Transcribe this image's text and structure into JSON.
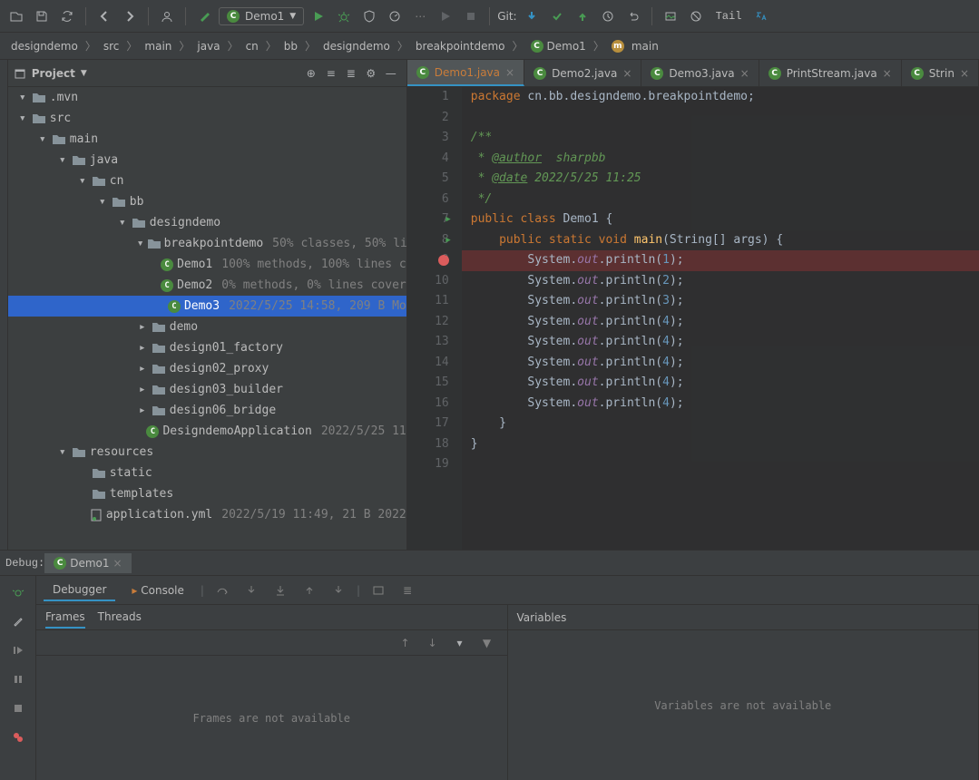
{
  "toolbar": {
    "run_config": "Demo1",
    "git_label": "Git:",
    "tail_label": "Tail"
  },
  "breadcrumb": [
    "designdemo",
    "src",
    "main",
    "java",
    "cn",
    "bb",
    "designdemo",
    "breakpointdemo",
    "Demo1",
    "main"
  ],
  "project": {
    "title": "Project",
    "tree": [
      {
        "depth": 0,
        "chev": "▾",
        "icon": "folder",
        "label": ".mvn"
      },
      {
        "depth": 0,
        "chev": "▾",
        "icon": "folder",
        "label": "src"
      },
      {
        "depth": 1,
        "chev": "▾",
        "icon": "folder",
        "label": "main"
      },
      {
        "depth": 2,
        "chev": "▾",
        "icon": "folder",
        "label": "java"
      },
      {
        "depth": 3,
        "chev": "▾",
        "icon": "folder",
        "label": "cn"
      },
      {
        "depth": 4,
        "chev": "▾",
        "icon": "folder",
        "label": "bb"
      },
      {
        "depth": 5,
        "chev": "▾",
        "icon": "folder",
        "label": "designdemo"
      },
      {
        "depth": 6,
        "chev": "▾",
        "icon": "folder",
        "label": "breakpointdemo",
        "meta": "50% classes, 50% li"
      },
      {
        "depth": 7,
        "chev": "",
        "icon": "class",
        "label": "Demo1",
        "meta": "100% methods, 100% lines c"
      },
      {
        "depth": 7,
        "chev": "",
        "icon": "class",
        "label": "Demo2",
        "meta": "0% methods, 0% lines cover"
      },
      {
        "depth": 7,
        "chev": "",
        "icon": "class",
        "label": "Demo3",
        "meta": "2022/5/25 14:58, 209 B Mo",
        "selected": true
      },
      {
        "depth": 6,
        "chev": "▸",
        "icon": "folder",
        "label": "demo"
      },
      {
        "depth": 6,
        "chev": "▸",
        "icon": "folder",
        "label": "design01_factory"
      },
      {
        "depth": 6,
        "chev": "▸",
        "icon": "folder",
        "label": "design02_proxy"
      },
      {
        "depth": 6,
        "chev": "▸",
        "icon": "folder",
        "label": "design03_builder"
      },
      {
        "depth": 6,
        "chev": "▸",
        "icon": "folder",
        "label": "design06_bridge"
      },
      {
        "depth": 6,
        "chev": "",
        "icon": "class",
        "label": "DesigndemoApplication",
        "meta": "2022/5/25 11"
      },
      {
        "depth": 2,
        "chev": "▾",
        "icon": "folder",
        "label": "resources"
      },
      {
        "depth": 3,
        "chev": "",
        "icon": "folder",
        "label": "static"
      },
      {
        "depth": 3,
        "chev": "",
        "icon": "folder",
        "label": "templates"
      },
      {
        "depth": 3,
        "chev": "",
        "icon": "yml",
        "label": "application.yml",
        "meta": "2022/5/19 11:49, 21 B 2022"
      }
    ]
  },
  "editor_tabs": [
    {
      "label": "Demo1.java",
      "active": true,
      "icon": "class"
    },
    {
      "label": "Demo2.java",
      "active": false,
      "icon": "class"
    },
    {
      "label": "Demo3.java",
      "active": false,
      "icon": "class"
    },
    {
      "label": "PrintStream.java",
      "active": false,
      "icon": "class"
    },
    {
      "label": "Strin",
      "active": false,
      "icon": "class"
    }
  ],
  "code": {
    "package_kw": "package",
    "package_val": "cn.bb.designdemo.breakpointdemo",
    "doc_open": "/**",
    "author_tag": "@author",
    "author_val": "sharpbb",
    "date_tag": "@date",
    "date_val": "2022/5/25 11:25",
    "doc_close": " */",
    "public": "public",
    "class_kw": "class",
    "class_name": "Demo1",
    "static": "static",
    "void": "void",
    "main": "main",
    "main_params": "(String[] args) {",
    "sys": "System.",
    "out": "out",
    "println": ".println",
    "line_nums": [
      "1",
      "2",
      "3",
      "4",
      "5",
      "6",
      "7",
      "8",
      "9",
      "10",
      "11",
      "12",
      "13",
      "14",
      "15",
      "16",
      "17",
      "18",
      "19"
    ],
    "print_args": [
      "1",
      "2",
      "3",
      "4",
      "4",
      "4",
      "4",
      "4"
    ]
  },
  "debug": {
    "label": "Debug:",
    "tab": "Demo1",
    "debugger_tab": "Debugger",
    "console_tab": "Console",
    "frames_tab": "Frames",
    "threads_tab": "Threads",
    "variables_tab": "Variables",
    "frames_msg": "Frames are not available",
    "vars_msg": "Variables are not available"
  }
}
